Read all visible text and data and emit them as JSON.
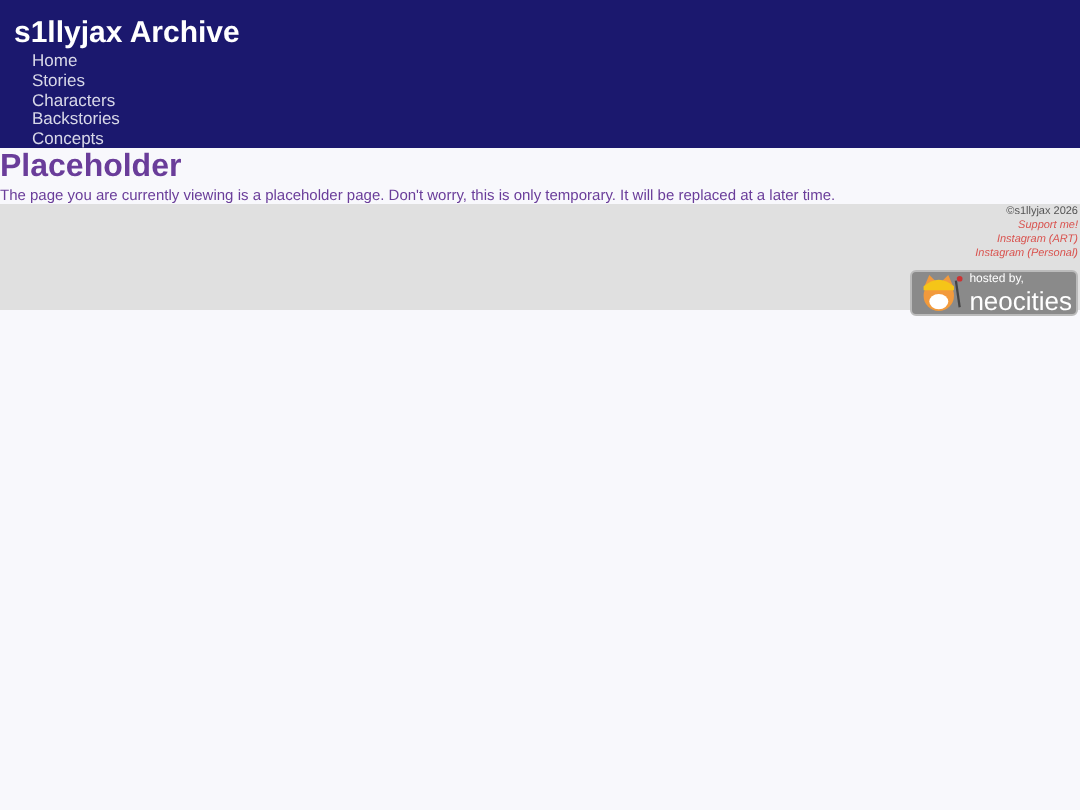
{
  "header": {
    "title": "s1llyjax Archive",
    "nav": [
      "Home",
      "Stories",
      "Characters",
      "Backstories",
      "Concepts"
    ]
  },
  "main": {
    "heading": "Placeholder",
    "text": "The page you are currently viewing is a placeholder page. Don't worry, this is only temporary. It will be replaced at a later time."
  },
  "footer": {
    "copyright": "©s1llyjax 2026",
    "links": [
      "Support me!",
      "Instagram (ART)",
      "Instagram (Personal)"
    ],
    "badge": {
      "line_1": "hosted by,",
      "line_2": "neocities"
    }
  }
}
